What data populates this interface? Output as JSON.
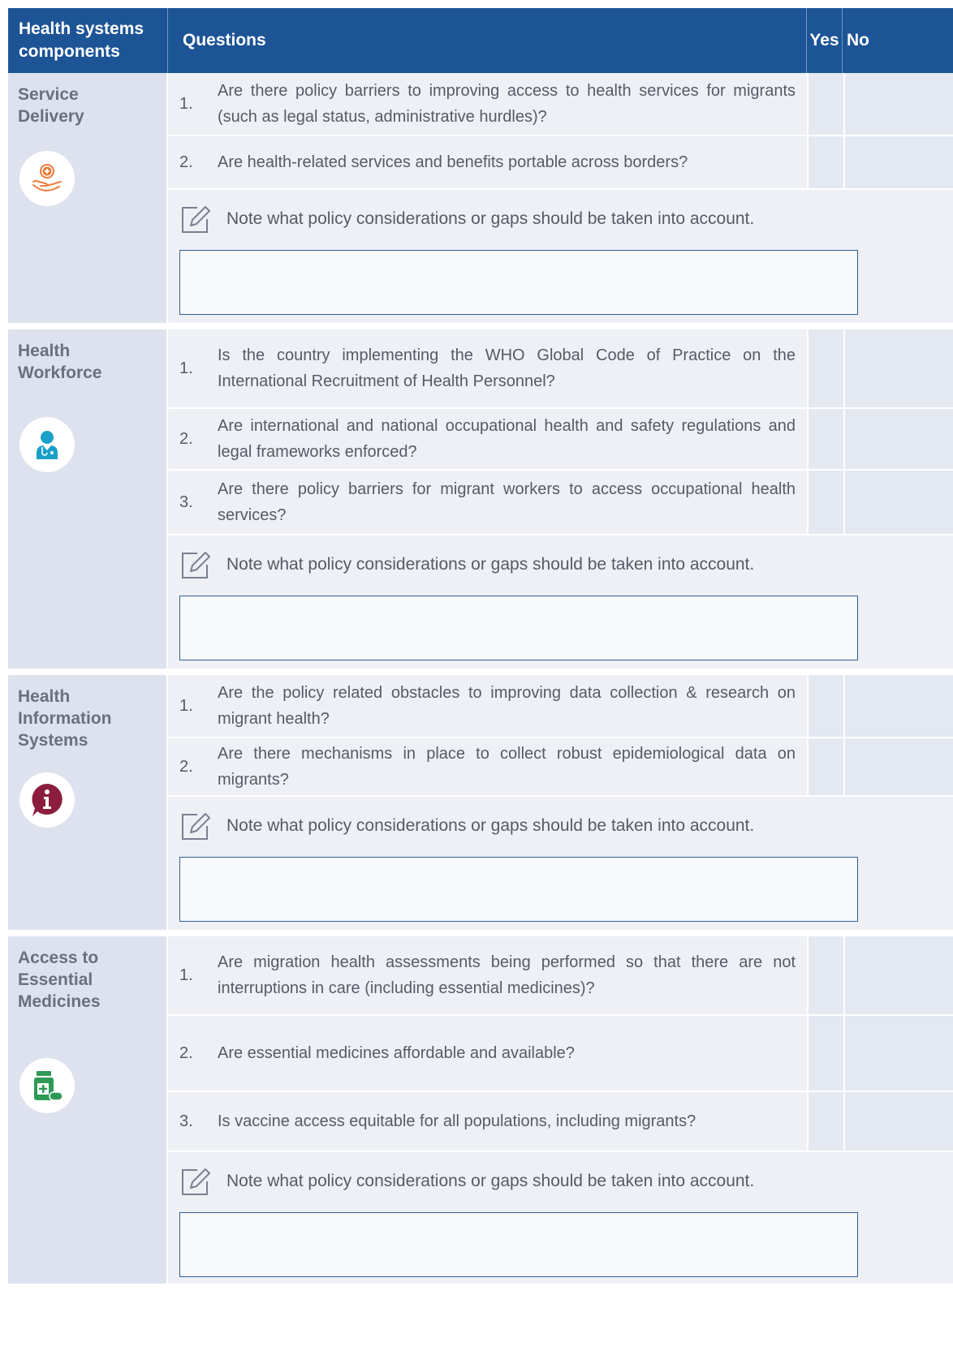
{
  "header": {
    "col1": "Health systems components",
    "col2": "Questions",
    "col3": "Yes",
    "col4": "No"
  },
  "note_text": "Note what policy considerations or gaps should be taken into account.",
  "sections": [
    {
      "label": "Service Delivery",
      "icon": "hand-medical-cross-icon",
      "questions": [
        {
          "num": "1.",
          "text": "Are there policy barriers to improving access to health services for migrants (such as legal status, administrative hurdles)?"
        },
        {
          "num": "2.",
          "text": "Are health-related services and benefits portable across borders?"
        }
      ]
    },
    {
      "label": "Health Workforce",
      "icon": "health-worker-icon",
      "questions": [
        {
          "num": "1.",
          "text": "Is the country implementing the WHO Global Code of Practice on the International Recruitment of Health Personnel?"
        },
        {
          "num": "2.",
          "text": "Are international and national occupational health and safety regulations and legal frameworks enforced?"
        },
        {
          "num": "3.",
          "text": "Are there policy barriers for migrant workers to access occupational health services?"
        }
      ]
    },
    {
      "label": "Health Information Systems",
      "icon": "information-icon",
      "questions": [
        {
          "num": "1.",
          "text": "Are the policy related obstacles to improving data collection & research on migrant health?"
        },
        {
          "num": "2.",
          "text": "Are there mechanisms in place to collect robust epidemiological data on migrants?"
        }
      ]
    },
    {
      "label": "Access to Essential Medicines",
      "icon": "medicine-bottle-icon",
      "questions": [
        {
          "num": "1.",
          "text": "Are migration health assessments being performed so that there are not interruptions in care (including essential medicines)?"
        },
        {
          "num": "2.",
          "text": "Are essential medicines affordable and available?"
        },
        {
          "num": "3.",
          "text": "Is vaccine access equitable for all populations, including migrants?"
        }
      ]
    }
  ],
  "colors": {
    "header_bg": "#1d5496",
    "label_bg": "#dde2ee",
    "row_bg": "#eef0f6",
    "icon_orange": "#ee7b3a",
    "icon_teal": "#1aa0c8",
    "icon_maroon": "#8b1e3f",
    "icon_green": "#2e9a55"
  }
}
